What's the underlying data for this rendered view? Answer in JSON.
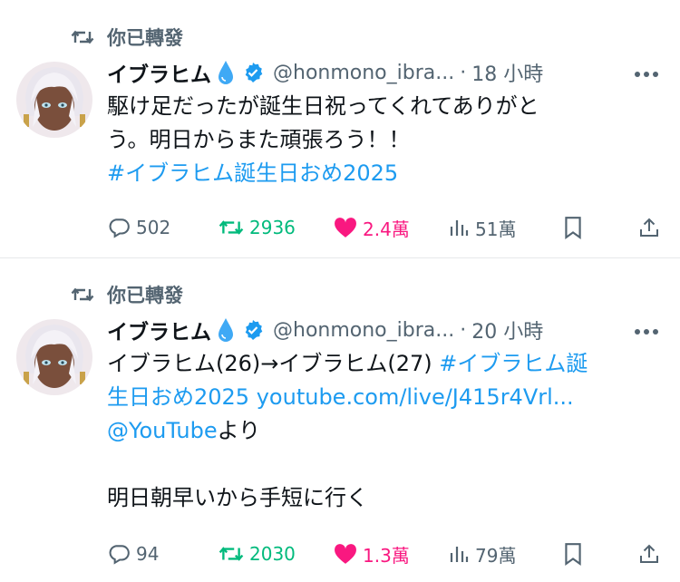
{
  "colors": {
    "link": "#1d9bf0",
    "repost_active": "#00ba7c",
    "like_active": "#f91880",
    "verified": "#1d9bf0",
    "muted": "#536471"
  },
  "tweets": [
    {
      "repost_label": "你已轉發",
      "display_name": "イブラヒム",
      "handle": "@honmono_ibra...",
      "separator": "·",
      "time": "18 小時",
      "lines": [
        [
          {
            "t": "駆け足だったが誕生日祝ってくれてありがと",
            "link": false
          }
        ],
        [
          {
            "t": "う。明日からまた頑張ろう！！",
            "link": false
          }
        ],
        [
          {
            "t": "#イブラヒム誕生日おめ2025",
            "link": true
          }
        ]
      ],
      "stats": {
        "replies": "502",
        "reposts": "2936",
        "likes": "2.4萬",
        "views": "51萬"
      },
      "icons": {
        "reply": "reply-icon",
        "repost": "repost-icon",
        "like": "heart-filled-icon",
        "views": "views-icon",
        "bookmark": "bookmark-icon",
        "share": "share-icon"
      }
    },
    {
      "repost_label": "你已轉發",
      "display_name": "イブラヒム",
      "handle": "@honmono_ibra...",
      "separator": "·",
      "time": "20 小時",
      "lines": [
        [
          {
            "t": "イブラヒム(26)→イブラヒム(27) ",
            "link": false
          },
          {
            "t": "#イブラヒム誕",
            "link": true
          }
        ],
        [
          {
            "t": "生日おめ2025",
            "link": true
          },
          {
            "t": " ",
            "link": false
          },
          {
            "t": "youtube.com/live/J415r4Vrl...",
            "link": true
          }
        ],
        [
          {
            "t": "@YouTube",
            "link": true
          },
          {
            "t": "より",
            "link": false
          }
        ],
        [
          {
            "t": "",
            "link": false
          }
        ],
        [
          {
            "t": "明日朝早いから手短に行く",
            "link": false
          }
        ]
      ],
      "stats": {
        "replies": "94",
        "reposts": "2030",
        "likes": "1.3萬",
        "views": "79萬"
      },
      "icons": {
        "reply": "reply-icon",
        "repost": "repost-icon",
        "like": "heart-filled-icon",
        "views": "views-icon",
        "bookmark": "bookmark-icon",
        "share": "share-icon"
      }
    }
  ]
}
